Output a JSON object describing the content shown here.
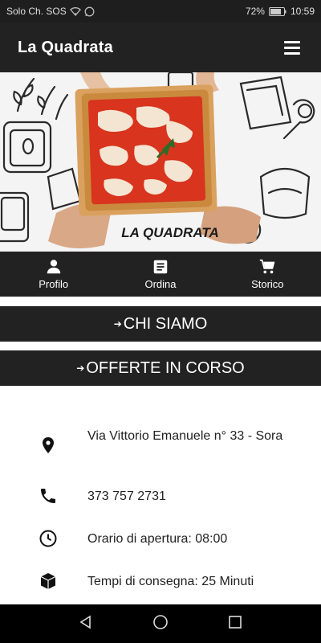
{
  "status_bar": {
    "carrier": "Solo Ch. SOS",
    "battery": "72%",
    "time": "10:59",
    "icons": [
      "wifi-icon",
      "whatsapp-icon",
      "battery-icon"
    ]
  },
  "app_bar": {
    "title": "La Quadrata",
    "menu_icon": "hamburger-menu-icon"
  },
  "hero": {
    "logo_text": "LA QUADRATA"
  },
  "nav": {
    "items": [
      {
        "label": "Profilo",
        "icon": "person-icon"
      },
      {
        "label": "Ordina",
        "icon": "list-icon"
      },
      {
        "label": "Storico",
        "icon": "cart-icon"
      }
    ]
  },
  "sections": {
    "about": {
      "arrow": "➔",
      "label": "CHI SIAMO"
    },
    "offers": {
      "arrow": "➔",
      "label": "OFFERTE IN CORSO"
    }
  },
  "info": {
    "address": "Via Vittorio Emanuele n° 33 - Sora",
    "phone": "373 757 2731",
    "hours": "Orario di apertura: 08:00",
    "delivery": "Tempi di consegna: 25 Minuti"
  },
  "colors": {
    "bar": "#222222",
    "tomato": "#d8341e",
    "cheese": "#f6efdc",
    "crust": "#c98a3e"
  }
}
